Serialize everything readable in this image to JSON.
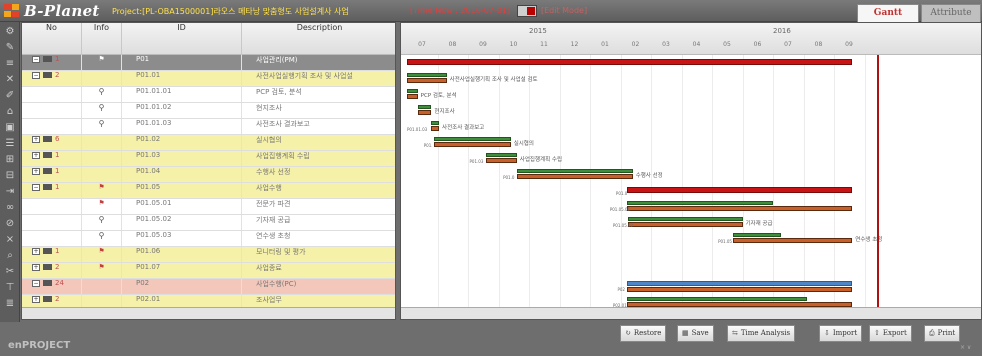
{
  "app": {
    "brand": "B-Planet",
    "footer_brand": "enPROJECT",
    "footer_corner": "× ∨",
    "project_label": "Project:[PL-OBA1500001]라오스 메타낭 맞춤형도 사업설계사 사업",
    "time_now_label": "[Time Now : 2016-07-01]",
    "edit_mode_label": "[Edit Mode]",
    "tabs": [
      "Gantt",
      "Attribute"
    ]
  },
  "toolbar_icons": [
    "settings-icon",
    "pencil-icon",
    "bars-icon",
    "x-icon",
    "brush-icon",
    "bank-icon",
    "save-icon",
    "list-icon",
    "list-plus-icon",
    "list-minus-icon",
    "indent-icon",
    "link-icon",
    "unlink-icon",
    "close-icon",
    "zoom-icon",
    "cut-icon",
    "filter-icon",
    "align-icon"
  ],
  "grid": {
    "columns": [
      "No",
      "Info",
      "ID",
      "Description"
    ],
    "rows": [
      {
        "no": "1",
        "expander": "−",
        "info": "⚑",
        "id": "P01",
        "desc": "사업관리(PM)",
        "style": "dark"
      },
      {
        "no": "2",
        "expander": "−",
        "info": "",
        "id": "P01.01",
        "desc": "사전사업실행기획 조사 및 사업설",
        "style": "hl"
      },
      {
        "no": "",
        "expander": "",
        "info": "",
        "id": "P01.01.01",
        "desc": "PCP 검토, 분석",
        "style": "plain"
      },
      {
        "no": "",
        "expander": "",
        "info": "",
        "id": "P01.01.02",
        "desc": "현지조사",
        "style": "plain"
      },
      {
        "no": "",
        "expander": "",
        "info": "",
        "id": "P01.01.03",
        "desc": "사전조사 결과보고",
        "style": "plain"
      },
      {
        "no": "6",
        "expander": "+",
        "info": "",
        "id": "P01.02",
        "desc": "실시협의",
        "style": "hl"
      },
      {
        "no": "1",
        "expander": "+",
        "info": "",
        "id": "P01.03",
        "desc": "사업집행계획 수립",
        "style": "hl"
      },
      {
        "no": "1",
        "expander": "+",
        "info": "",
        "id": "P01.04",
        "desc": "수행사 선정",
        "style": "hl"
      },
      {
        "no": "1",
        "expander": "−",
        "info": "⚑",
        "id": "P01.05",
        "desc": "사업수행",
        "style": "hl"
      },
      {
        "no": "",
        "expander": "",
        "info": "⚑",
        "id": "P01.05.01",
        "desc": "전문가 파견",
        "style": "plain"
      },
      {
        "no": "",
        "expander": "",
        "info": "",
        "id": "P01.05.02",
        "desc": "기자재 공급",
        "style": "plain"
      },
      {
        "no": "",
        "expander": "",
        "info": "",
        "id": "P01.05.03",
        "desc": "연수생 초청",
        "style": "plain"
      },
      {
        "no": "1",
        "expander": "+",
        "info": "⚑",
        "id": "P01.06",
        "desc": "모니터링 및 평가",
        "style": "hl"
      },
      {
        "no": "2",
        "expander": "+",
        "info": "⚑",
        "id": "P01.07",
        "desc": "사업종료",
        "style": "hl"
      },
      {
        "no": "24",
        "expander": "−",
        "info": "",
        "id": "P02",
        "desc": "사업수행(PC)",
        "style": "salmon"
      },
      {
        "no": "2",
        "expander": "+",
        "info": "",
        "id": "P02.01",
        "desc": "조사업무",
        "style": "hl"
      }
    ]
  },
  "gantt": {
    "years": [
      {
        "label": "2015",
        "month_index": 4
      },
      {
        "label": "2016",
        "month_index": 12
      }
    ],
    "months": [
      "07",
      "08",
      "09",
      "10",
      "11",
      "12",
      "01",
      "02",
      "03",
      "04",
      "05",
      "06",
      "07",
      "08",
      "09"
    ],
    "today_label": "2016-07-01",
    "tasks": [
      {
        "row": 0,
        "kind": "summary",
        "start": 0.0,
        "end": 14.6,
        "label": "",
        "progress": 1.0
      },
      {
        "row": 1,
        "kind": "task",
        "start": 0.0,
        "end": 1.3,
        "label": "사전사업실행기획 조사 및 사업설 검토",
        "progress": 1.0
      },
      {
        "row": 2,
        "kind": "task",
        "start": 0.0,
        "end": 0.35,
        "label": "PCP 검토, 분석",
        "progress": 1.0
      },
      {
        "row": 3,
        "kind": "task",
        "start": 0.35,
        "end": 0.8,
        "label": "현지조사",
        "progress": 1.0
      },
      {
        "row": 4,
        "kind": "task",
        "start": 0.8,
        "end": 1.05,
        "label": "사전조사 결과보고",
        "progress": 1.0
      },
      {
        "row": 5,
        "kind": "task",
        "start": 0.9,
        "end": 3.4,
        "label": "실시협의",
        "progress": 1.0
      },
      {
        "row": 6,
        "kind": "task",
        "start": 2.6,
        "end": 3.6,
        "label": "사업집행계획 수립",
        "progress": 1.0
      },
      {
        "row": 7,
        "kind": "task",
        "start": 3.6,
        "end": 7.4,
        "label": "수행사 선정",
        "progress": 1.0
      },
      {
        "row": 8,
        "kind": "summary",
        "start": 7.2,
        "end": 14.6,
        "label": "",
        "progress": 0.7
      },
      {
        "row": 9,
        "kind": "task",
        "start": 7.2,
        "end": 14.6,
        "label": "",
        "progress": 0.65
      },
      {
        "row": 10,
        "kind": "task",
        "start": 7.25,
        "end": 11.0,
        "label": "기자재 공급",
        "progress": 1.0
      },
      {
        "row": 11,
        "kind": "task",
        "start": 10.7,
        "end": 14.6,
        "label": "연수생 초청",
        "progress": 0.4
      },
      {
        "row": 14,
        "kind": "blue",
        "start": 7.2,
        "end": 14.6,
        "label": "",
        "progress": 1.0
      },
      {
        "row": 15,
        "kind": "task",
        "start": 7.2,
        "end": 14.6,
        "label": "",
        "progress": 0.8
      }
    ],
    "bar_tags": [
      {
        "row": 4,
        "text": "P01.01.03",
        "month": 0.0
      },
      {
        "row": 5,
        "text": "P01.",
        "month": 0.55
      },
      {
        "row": 6,
        "text": "P01.03",
        "month": 2.05
      },
      {
        "row": 7,
        "text": "P01.0",
        "month": 3.15
      },
      {
        "row": 8,
        "text": "P01.0",
        "month": 6.85
      },
      {
        "row": 9,
        "text": "P01.05.01",
        "month": 6.65
      },
      {
        "row": 10,
        "text": "P01.05.02",
        "month": 6.75
      },
      {
        "row": 11,
        "text": "P01.05",
        "month": 10.2
      },
      {
        "row": 14,
        "text": "P02",
        "month": 6.9
      },
      {
        "row": 15,
        "text": "P02.01",
        "month": 6.75
      }
    ]
  },
  "actions": [
    {
      "name": "restore-button",
      "icon": "↻",
      "label": "Restore"
    },
    {
      "name": "save-button",
      "icon": "▦",
      "label": "Save"
    },
    {
      "name": "time-analysis-button",
      "icon": "⇆",
      "label": "Time Analysis"
    },
    {
      "name": "import-button",
      "icon": "⇩",
      "label": "Import"
    },
    {
      "name": "export-button",
      "icon": "⇧",
      "label": "Export"
    },
    {
      "name": "print-button",
      "icon": "⎙",
      "label": "Print"
    }
  ]
}
